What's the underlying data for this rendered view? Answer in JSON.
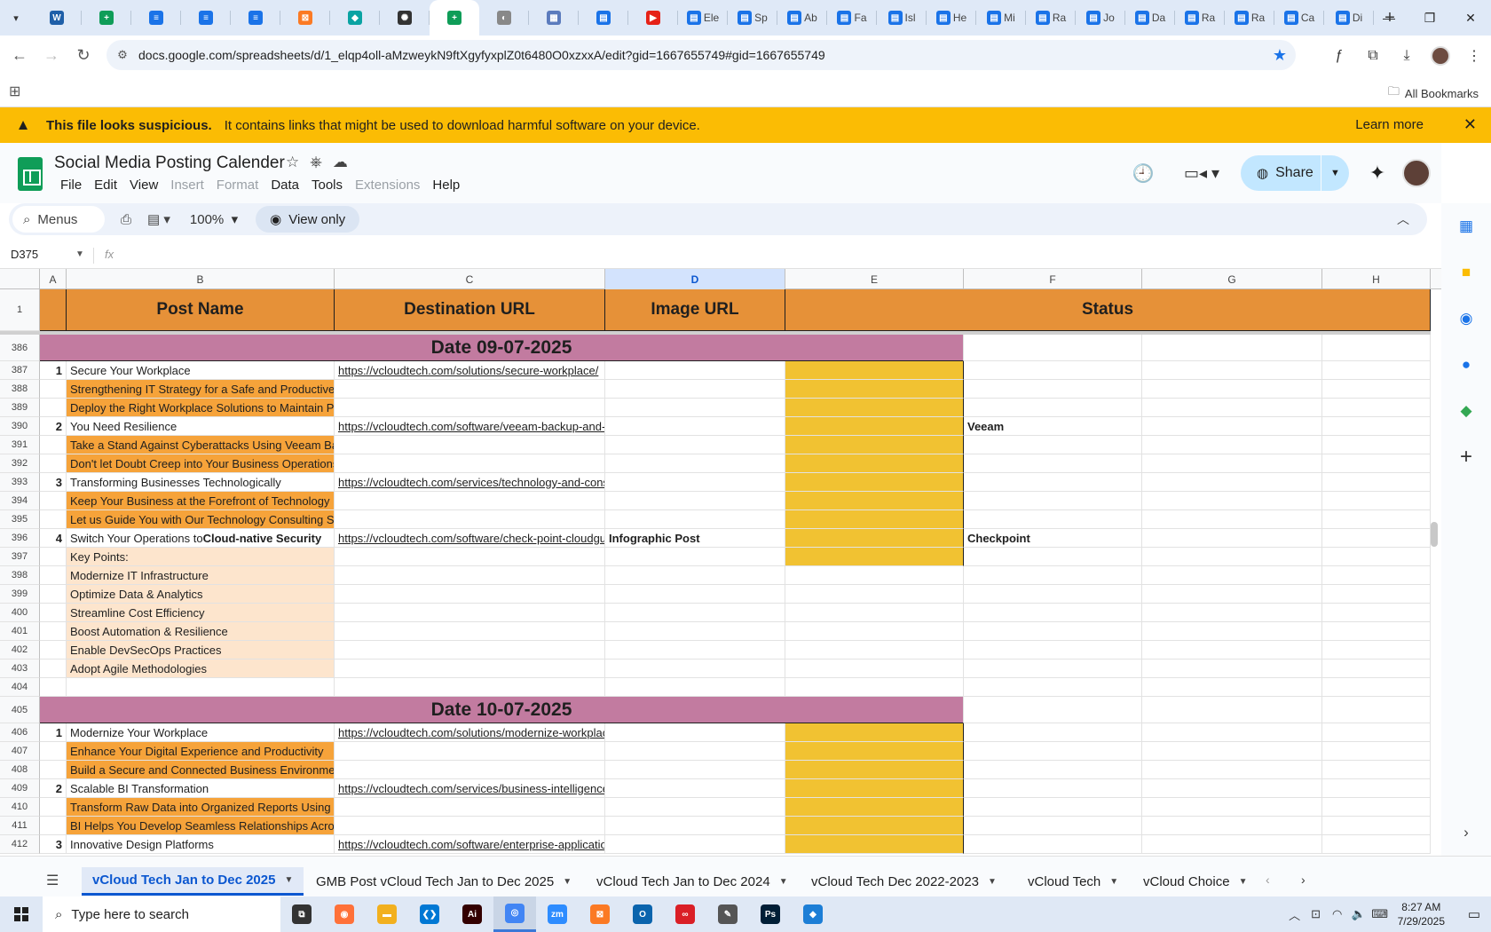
{
  "browser": {
    "tabs": [
      {
        "icon": "wordpress-icon",
        "color": "#1f5fa8",
        "glyph": "W",
        "title": ""
      },
      {
        "icon": "sheets-icon",
        "color": "#0f9d58",
        "glyph": "+",
        "title": ""
      },
      {
        "icon": "docs-icon",
        "color": "#1a73e8",
        "glyph": "≡",
        "title": ""
      },
      {
        "icon": "docs-icon",
        "color": "#1a73e8",
        "glyph": "≡",
        "title": ""
      },
      {
        "icon": "docs-icon",
        "color": "#1a73e8",
        "glyph": "≡",
        "title": ""
      },
      {
        "icon": "xampp-icon",
        "color": "#fb7a24",
        "glyph": "⊠",
        "title": ""
      },
      {
        "icon": "web-icon",
        "color": "#0aa3a3",
        "glyph": "◆",
        "title": ""
      },
      {
        "icon": "openai-icon",
        "color": "#333333",
        "glyph": "✺",
        "title": ""
      },
      {
        "icon": "sheets-icon",
        "color": "#0f9d58",
        "glyph": "+",
        "title": "",
        "active": true
      },
      {
        "icon": "globe-icon",
        "color": "#888888",
        "glyph": "◐",
        "title": ""
      },
      {
        "icon": "grid-icon",
        "color": "#5b7bbd",
        "glyph": "▦",
        "title": ""
      },
      {
        "icon": "forms-icon",
        "color": "#1a73e8",
        "glyph": "▤",
        "title": ""
      },
      {
        "icon": "youtube-icon",
        "color": "#e62117",
        "glyph": "▶",
        "title": ""
      },
      {
        "icon": "forms-icon",
        "color": "#1a73e8",
        "glyph": "▤",
        "title": "Ele"
      },
      {
        "icon": "forms-icon",
        "color": "#1a73e8",
        "glyph": "▤",
        "title": "Sp"
      },
      {
        "icon": "forms-icon",
        "color": "#1a73e8",
        "glyph": "▤",
        "title": "Ab"
      },
      {
        "icon": "forms-icon",
        "color": "#1a73e8",
        "glyph": "▤",
        "title": "Fa"
      },
      {
        "icon": "forms-icon",
        "color": "#1a73e8",
        "glyph": "▤",
        "title": "Isl"
      },
      {
        "icon": "forms-icon",
        "color": "#1a73e8",
        "glyph": "▤",
        "title": "He"
      },
      {
        "icon": "forms-icon",
        "color": "#1a73e8",
        "glyph": "▤",
        "title": "Mi"
      },
      {
        "icon": "forms-icon",
        "color": "#1a73e8",
        "glyph": "▤",
        "title": "Ra"
      },
      {
        "icon": "forms-icon",
        "color": "#1a73e8",
        "glyph": "▤",
        "title": "Jo"
      },
      {
        "icon": "forms-icon",
        "color": "#1a73e8",
        "glyph": "▤",
        "title": "Da"
      },
      {
        "icon": "forms-icon",
        "color": "#1a73e8",
        "glyph": "▤",
        "title": "Ra"
      },
      {
        "icon": "forms-icon",
        "color": "#1a73e8",
        "glyph": "▤",
        "title": "Ra"
      },
      {
        "icon": "forms-icon",
        "color": "#1a73e8",
        "glyph": "▤",
        "title": "Ca"
      },
      {
        "icon": "forms-icon",
        "color": "#1a73e8",
        "glyph": "▤",
        "title": "Di"
      }
    ],
    "url": "docs.google.com/spreadsheets/d/1_elqp4oll-aMzweykN9ftXgyfyxplZ0t6480O0xzxxA/edit?gid=1667655749#gid=1667655749",
    "all_bookmarks": "All Bookmarks"
  },
  "banner": {
    "title": "This file looks suspicious.",
    "message": "It contains links that might be used to download harmful software on your device.",
    "learn_more": "Learn more"
  },
  "app": {
    "title": "Social Media Posting Calender",
    "menus": [
      {
        "label": "File",
        "dim": false
      },
      {
        "label": "Edit",
        "dim": false
      },
      {
        "label": "View",
        "dim": false
      },
      {
        "label": "Insert",
        "dim": true
      },
      {
        "label": "Format",
        "dim": true
      },
      {
        "label": "Data",
        "dim": false
      },
      {
        "label": "Tools",
        "dim": false
      },
      {
        "label": "Extensions",
        "dim": true
      },
      {
        "label": "Help",
        "dim": false
      }
    ],
    "share_label": "Share",
    "menus_search": "Menus",
    "zoom": "100%",
    "view_only": "View only",
    "name_box": "D375",
    "fx": "fx"
  },
  "columns": [
    "A",
    "B",
    "C",
    "D",
    "E",
    "F",
    "G",
    "H"
  ],
  "selected_column": "D",
  "header_row": {
    "row": "1",
    "post_name": "Post Name",
    "destination_url": "Destination URL",
    "image_url": "Image URL",
    "status": "Status"
  },
  "rows": [
    {
      "n": "386",
      "type": "date",
      "text": "Date 09-07-2025"
    },
    {
      "n": "387",
      "type": "post",
      "num": "1",
      "b": "Secure Your Workplace",
      "c": "https://vcloudtech.com/solutions/secure-workplace/",
      "d": "",
      "f": "",
      "e": true
    },
    {
      "n": "388",
      "type": "sub",
      "b": "Strengthening IT Strategy for a Safe and Productive Workplace",
      "e": true
    },
    {
      "n": "389",
      "type": "sub",
      "b": "Deploy the Right Workplace Solutions to Maintain Productivity",
      "e": true
    },
    {
      "n": "390",
      "type": "post",
      "num": "2",
      "b": "You Need Resilience",
      "c": "https://vcloudtech.com/software/veeam-backup-and-replication/",
      "d": "",
      "f": "Veeam",
      "e": true
    },
    {
      "n": "391",
      "type": "sub",
      "b": "Take a Stand Against Cyberattacks Using Veeam Backup",
      "e": true
    },
    {
      "n": "392",
      "type": "sub",
      "b": "Don't let Doubt Creep into Your Business Operations",
      "e": true
    },
    {
      "n": "393",
      "type": "post",
      "num": "3",
      "b": "Transforming Businesses Technologically",
      "c": "https://vcloudtech.com/services/technology-and-consulting/",
      "d": "",
      "f": "",
      "e": true
    },
    {
      "n": "394",
      "type": "sub",
      "b": "Keep Your Business at the Forefront of Technology",
      "e": true
    },
    {
      "n": "395",
      "type": "sub",
      "b": "Let us Guide You with Our Technology Consulting Services",
      "e": true
    },
    {
      "n": "396",
      "type": "post",
      "num": "4",
      "b": "Switch Your Operations to ",
      "b_bold": "Cloud-native Security",
      "c": "https://vcloudtech.com/software/check-point-cloudguard/",
      "d": "Infographic Post",
      "f": "Checkpoint",
      "e": true
    },
    {
      "n": "397",
      "type": "peach",
      "b": "Key Points:",
      "e": true
    },
    {
      "n": "398",
      "type": "peach",
      "b": "Modernize IT Infrastructure",
      "e": false
    },
    {
      "n": "399",
      "type": "peach",
      "b": "Optimize Data & Analytics",
      "e": false
    },
    {
      "n": "400",
      "type": "peach",
      "b": "Streamline Cost Efficiency",
      "e": false
    },
    {
      "n": "401",
      "type": "peach",
      "b": "Boost Automation & Resilience",
      "e": false
    },
    {
      "n": "402",
      "type": "peach",
      "b": "Enable DevSecOps Practices",
      "e": false
    },
    {
      "n": "403",
      "type": "peach",
      "b": "Adopt Agile Methodologies",
      "e": false
    },
    {
      "n": "404",
      "type": "empty"
    },
    {
      "n": "405",
      "type": "date",
      "text": "Date 10-07-2025"
    },
    {
      "n": "406",
      "type": "post",
      "num": "1",
      "b": "Modernize Your Workplace",
      "c": "https://vcloudtech.com/solutions/modernize-workplace/",
      "d": "",
      "f": "",
      "e": true
    },
    {
      "n": "407",
      "type": "sub",
      "b": "Enhance Your Digital Experience and Productivity",
      "e": true
    },
    {
      "n": "408",
      "type": "sub",
      "b": "Build a Secure and Connected Business Environment",
      "e": true
    },
    {
      "n": "409",
      "type": "post",
      "num": "2",
      "b": "Scalable BI Transformation",
      "c": "https://vcloudtech.com/services/business-intelligence/",
      "d": "",
      "f": "",
      "e": true
    },
    {
      "n": "410",
      "type": "sub",
      "b": "Transform Raw Data into Organized Reports Using BI",
      "e": true
    },
    {
      "n": "411",
      "type": "sub",
      "b": "BI Helps You Develop Seamless Relationships Across Teams",
      "e": true
    },
    {
      "n": "412",
      "type": "post",
      "num": "3",
      "b": "Innovative Design Platforms",
      "c": "https://vcloudtech.com/software/enterprise-applications/",
      "d": "",
      "f": "",
      "e": true
    }
  ],
  "sheet_tabs": [
    {
      "label": "vCloud Tech Jan to Dec 2025",
      "active": true
    },
    {
      "label": "GMB Post vCloud Tech Jan to Dec 2025",
      "active": false
    },
    {
      "label": "vCloud Tech Jan to Dec 2024",
      "active": false
    },
    {
      "label": "vCloud Tech Dec 2022-2023",
      "active": false
    },
    {
      "label": "vCloud Tech",
      "active": false
    },
    {
      "label": "vCloud Choice",
      "active": false
    }
  ],
  "taskbar": {
    "search_placeholder": "Type here to search",
    "time": "8:27 AM",
    "date": "7/29/2025",
    "apps": [
      {
        "name": "task-view-icon",
        "color": "#333333",
        "glyph": "⧉"
      },
      {
        "name": "firefox-icon",
        "color": "#ff7139",
        "glyph": "◉"
      },
      {
        "name": "file-explorer-icon",
        "color": "#f2b01e",
        "glyph": "▬"
      },
      {
        "name": "vscode-icon",
        "color": "#0078d4",
        "glyph": "❮❯"
      },
      {
        "name": "illustrator-icon",
        "color": "#330000",
        "glyph": "Ai"
      },
      {
        "name": "chrome-icon",
        "color": "#4285f4",
        "glyph": "◎",
        "active": true
      },
      {
        "name": "zoom-icon",
        "color": "#2d8cff",
        "glyph": "zm"
      },
      {
        "name": "xampp-icon",
        "color": "#fb7a24",
        "glyph": "⊠"
      },
      {
        "name": "outlook-icon",
        "color": "#0a64ad",
        "glyph": "O"
      },
      {
        "name": "creative-cloud-icon",
        "color": "#da1f26",
        "glyph": "∞"
      },
      {
        "name": "pen-tool-icon",
        "color": "#555555",
        "glyph": "✎"
      },
      {
        "name": "photoshop-icon",
        "color": "#001e36",
        "glyph": "Ps"
      },
      {
        "name": "app-icon",
        "color": "#1c7ed6",
        "glyph": "◆"
      }
    ]
  }
}
